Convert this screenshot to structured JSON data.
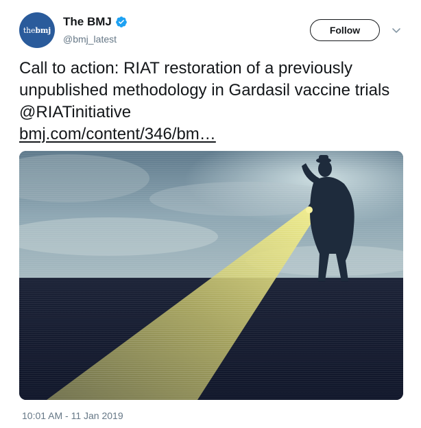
{
  "account": {
    "avatar_prefix": "the",
    "avatar_brand": "bmj",
    "display_name": "The BMJ",
    "verified": true,
    "verified_icon": "verified-badge-icon",
    "handle": "@bmj_latest"
  },
  "actions": {
    "follow_label": "Follow",
    "menu_icon": "chevron-down-icon"
  },
  "tweet": {
    "text": "Call to action: RIAT restoration of a previously unpublished methodology in Gardasil vaccine trials @RIATinitiative",
    "link_text": "bmj.com/content/346/bm…",
    "timestamp": "10:01 AM - 11 Jan 2019"
  },
  "media": {
    "description_icon": "illustration-man-with-flashlight"
  },
  "colors": {
    "brand_blue": "#2a5b9b",
    "verified_blue": "#1da1f2",
    "text": "#14171a",
    "secondary_text": "#657786"
  }
}
